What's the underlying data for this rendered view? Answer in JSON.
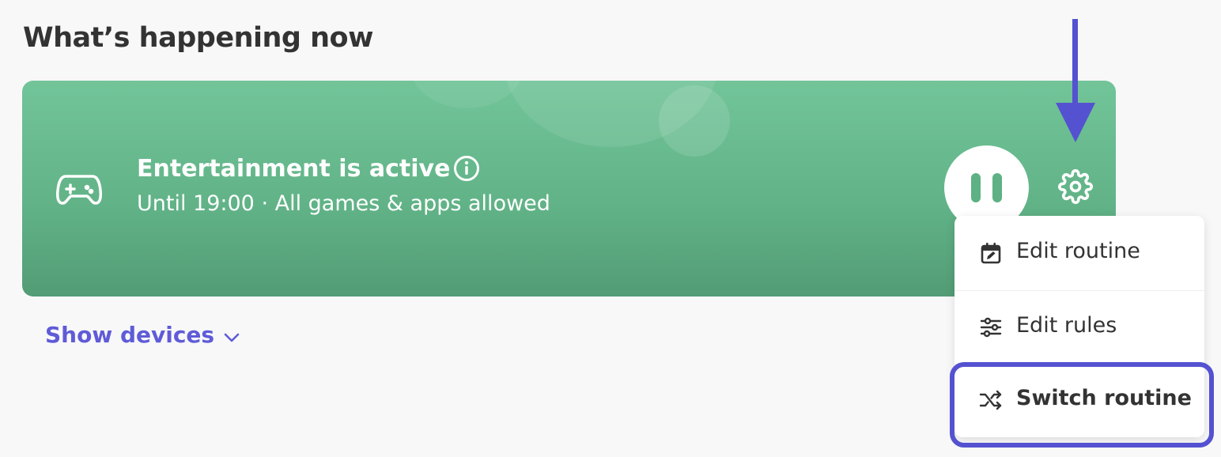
{
  "section": {
    "title": "What’s happening now"
  },
  "routine_card": {
    "title": "Entertainment is active",
    "subtitle": "Until 19:00 · All games & apps allowed",
    "icon": "gamepad-icon",
    "colors": {
      "card": "#62b488",
      "accent": "#5452d0"
    }
  },
  "menu": {
    "items": [
      {
        "label": "Edit routine",
        "icon": "calendar-edit-icon"
      },
      {
        "label": "Edit rules",
        "icon": "sliders-icon"
      },
      {
        "label": "Switch routine",
        "icon": "shuffle-icon",
        "highlighted": true
      }
    ]
  },
  "devices": {
    "toggle_label": "Show devices"
  }
}
